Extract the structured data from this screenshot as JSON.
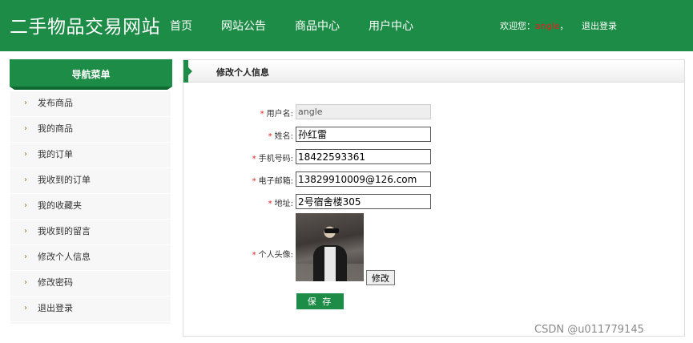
{
  "header": {
    "site_title": "二手物品交易网站",
    "nav": [
      {
        "label": "首页"
      },
      {
        "label": "网站公告"
      },
      {
        "label": "商品中心"
      },
      {
        "label": "用户中心"
      }
    ],
    "welcome_prefix": "欢迎您：",
    "username": "angle",
    "welcome_suffix": "，",
    "logout_label": "退出登录"
  },
  "sidebar": {
    "title": "导航菜单",
    "items": [
      {
        "label": "发布商品"
      },
      {
        "label": "我的商品"
      },
      {
        "label": "我的订单"
      },
      {
        "label": "我收到的订单"
      },
      {
        "label": "我的收藏夹"
      },
      {
        "label": "我收到的留言"
      },
      {
        "label": "修改个人信息"
      },
      {
        "label": "修改密码"
      },
      {
        "label": "退出登录"
      }
    ]
  },
  "main": {
    "title": "修改个人信息",
    "required_mark": "*",
    "fields": {
      "username": {
        "label": "用户名:",
        "value": "angle"
      },
      "name": {
        "label": "姓名:",
        "value": "孙红雷"
      },
      "phone": {
        "label": "手机号码:",
        "value": "18422593361"
      },
      "email": {
        "label": "电子邮箱:",
        "value": "13829910009@126.com"
      },
      "address": {
        "label": "地址:",
        "value": "2号宿舍楼305"
      },
      "avatar": {
        "label": "个人头像:"
      }
    },
    "edit_button": "修改",
    "save_button": "保 存"
  },
  "watermark": "CSDN @u011779145",
  "colors": {
    "brand_green": "#1c8c46",
    "username_red": "#e02020"
  }
}
